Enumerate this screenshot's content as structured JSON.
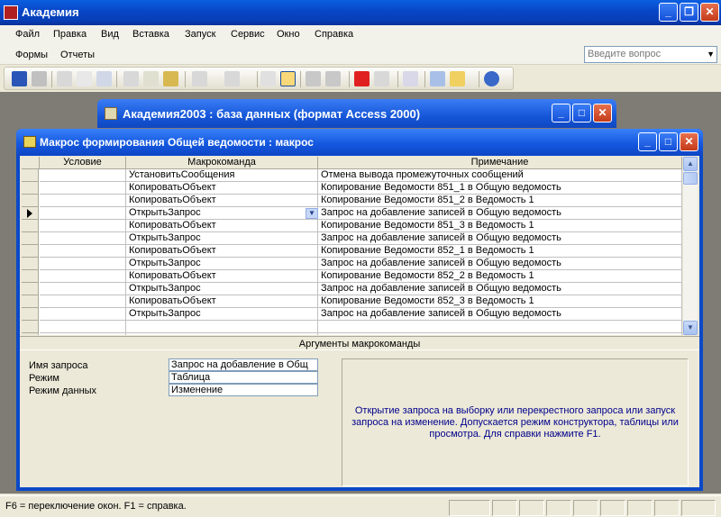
{
  "app": {
    "title": "Академия"
  },
  "menu": [
    "Файл",
    "Правка",
    "Вид",
    "Вставка",
    "Запуск",
    "Сервис",
    "Окно",
    "Справка"
  ],
  "forms_bar": {
    "forms": "Формы",
    "reports": "Отчеты"
  },
  "ask_box": {
    "placeholder": "Введите вопрос"
  },
  "db_window": {
    "title": "Академия2003 : база данных (формат Access 2000)"
  },
  "macro_window": {
    "title": "Макрос формирования Общей ведомости : макрос"
  },
  "grid": {
    "headers": {
      "condition": "Условие",
      "action": "Макрокоманда",
      "comment": "Примечание"
    },
    "rows": [
      {
        "action": "УстановитьСообщения",
        "comment": "Отмена вывода промежуточных сообщений"
      },
      {
        "action": "КопироватьОбъект",
        "comment": "Копирование Ведомости 851_1 в Общую ведомость"
      },
      {
        "action": "КопироватьОбъект",
        "comment": "Копирование Ведомости 851_2 в Ведомость 1"
      },
      {
        "action": "ОткрытьЗапрос",
        "comment": "Запрос на добавление записей в Общую ведомость"
      },
      {
        "action": "КопироватьОбъект",
        "comment": "Копирование Ведомости 851_3 в Ведомость 1"
      },
      {
        "action": "ОткрытьЗапрос",
        "comment": "Запрос на добавление записей в Общую ведомость"
      },
      {
        "action": "КопироватьОбъект",
        "comment": "Копирование Ведомости 852_1 в Ведомость 1"
      },
      {
        "action": "ОткрытьЗапрос",
        "comment": "Запрос на добавление записей в Общую ведомость"
      },
      {
        "action": "КопироватьОбъект",
        "comment": "Копирование Ведомости 852_2 в Ведомость 1"
      },
      {
        "action": "ОткрытьЗапрос",
        "comment": "Запрос на добавление записей в Общую ведомость"
      },
      {
        "action": "КопироватьОбъект",
        "comment": "Копирование Ведомости 852_3 в Ведомость 1"
      },
      {
        "action": "ОткрытьЗапрос",
        "comment": "Запрос на добавление записей в Общую ведомость"
      }
    ]
  },
  "args": {
    "title": "Аргументы макрокоманды",
    "properties": [
      {
        "label": "Имя запроса",
        "value": "Запрос на добавление в Общ"
      },
      {
        "label": "Режим",
        "value": "Таблица"
      },
      {
        "label": "Режим данных",
        "value": "Изменение"
      }
    ],
    "help": "Открытие запроса на выборку или перекрестного запроса или запуск запроса на изменение. Допускается режим конструктора, таблицы или просмотра. Для справки нажмите F1."
  },
  "status": {
    "text": "F6 = переключение окон.  F1 = справка."
  },
  "colors": {
    "titlebar": "#0a5fe0",
    "help_text": "#00008b",
    "workspace": "#7f7c75"
  }
}
